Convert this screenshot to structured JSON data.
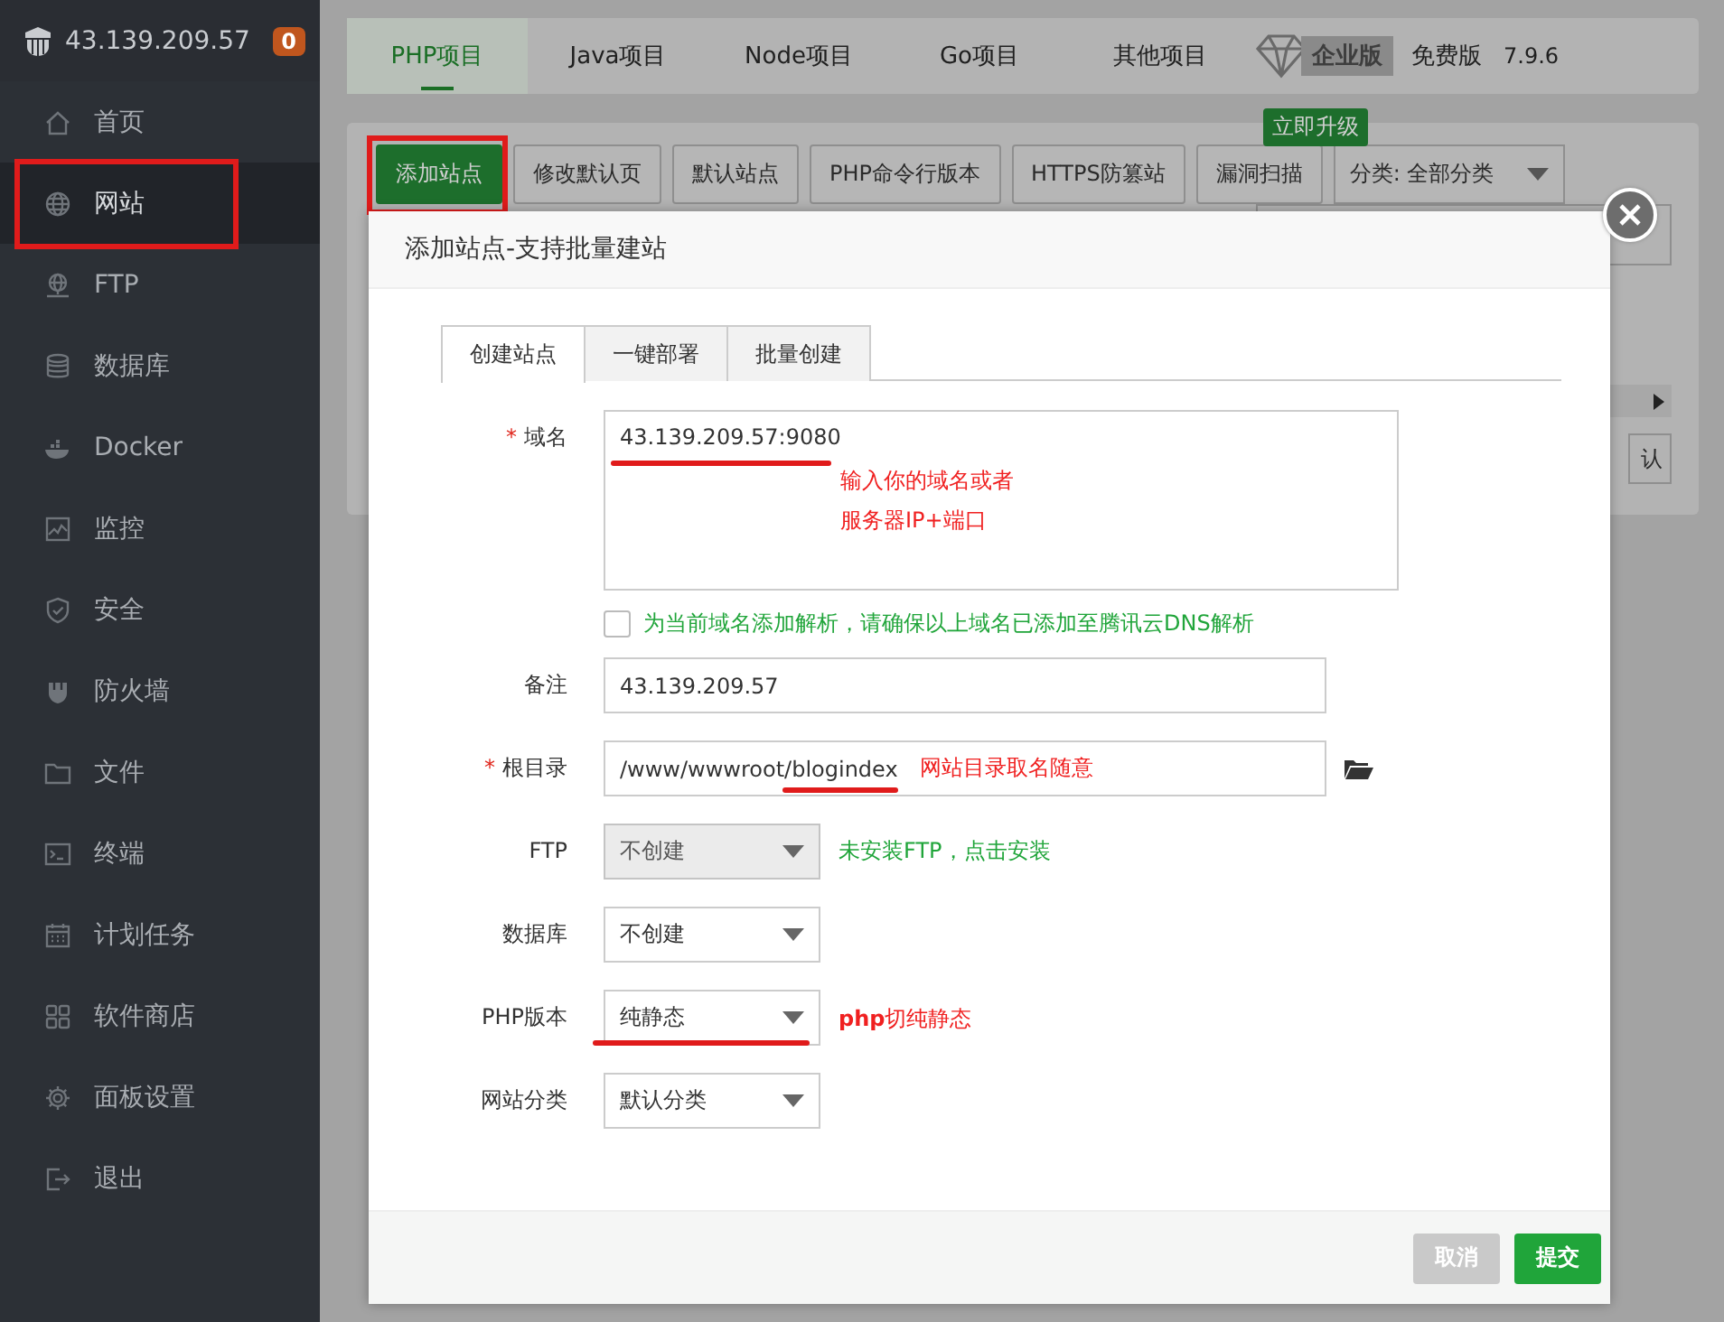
{
  "sidebar": {
    "host": "43.139.209.57",
    "badge": "0",
    "items": [
      {
        "label": "首页",
        "selected": false
      },
      {
        "label": "网站",
        "selected": true
      },
      {
        "label": "FTP",
        "selected": false
      },
      {
        "label": "数据库",
        "selected": false
      },
      {
        "label": "Docker",
        "selected": false
      },
      {
        "label": "监控",
        "selected": false
      },
      {
        "label": "安全",
        "selected": false
      },
      {
        "label": "防火墙",
        "selected": false
      },
      {
        "label": "文件",
        "selected": false
      },
      {
        "label": "终端",
        "selected": false
      },
      {
        "label": "计划任务",
        "selected": false
      },
      {
        "label": "软件商店",
        "selected": false
      },
      {
        "label": "面板设置",
        "selected": false
      },
      {
        "label": "退出",
        "selected": false
      }
    ]
  },
  "project_tabs": [
    {
      "label": "PHP项目",
      "selected": true
    },
    {
      "label": "Java项目",
      "selected": false
    },
    {
      "label": "Node项目",
      "selected": false
    },
    {
      "label": "Go项目",
      "selected": false
    },
    {
      "label": "其他项目",
      "selected": false
    }
  ],
  "edition": {
    "badge": "企业版",
    "label": "免费版",
    "version": "7.9.6"
  },
  "toolbar": {
    "buttons": [
      {
        "label": "添加站点",
        "primary": true
      },
      {
        "label": "修改默认页",
        "primary": false
      },
      {
        "label": "默认站点",
        "primary": false
      },
      {
        "label": "PHP命令行版本",
        "primary": false
      },
      {
        "label": "HTTPS防篡站",
        "primary": false
      },
      {
        "label": "漏洞扫描",
        "primary": false
      }
    ],
    "upgrade_badge": "立即升级",
    "category_select": "分类: 全部分类"
  },
  "background_button": "认",
  "dialog": {
    "title": "添加站点-支持批量建站",
    "tabs": [
      {
        "label": "创建站点",
        "selected": true
      },
      {
        "label": "一键部署",
        "selected": false
      },
      {
        "label": "批量创建",
        "selected": false
      }
    ],
    "fields": [
      {
        "kind": "textarea",
        "label": "域名",
        "required_mark": "*",
        "value": "43.139.209.57:9080",
        "annotation": [
          "输入你的域名或者",
          "服务器IP+端口"
        ]
      },
      {
        "kind": "checkbox",
        "label": "为当前域名添加解析，请确保以上域名已添加至腾讯云DNS解析",
        "checked": false
      },
      {
        "kind": "input",
        "label": "备注",
        "value": "43.139.209.57"
      },
      {
        "kind": "path",
        "label": "根目录",
        "required_mark": "*",
        "value": "/www/wwwroot/blogindex",
        "annotation": [
          "网站目录取名随意"
        ]
      },
      {
        "kind": "select",
        "label": "FTP",
        "value": "不创建",
        "disabled": true,
        "hint": "未安装FTP，点击安装"
      },
      {
        "kind": "select",
        "label": "数据库",
        "value": "不创建",
        "disabled": false
      },
      {
        "kind": "select",
        "label": "PHP版本",
        "value": "纯静态",
        "disabled": false,
        "annotation": [
          "**php**切纯静态"
        ]
      },
      {
        "kind": "select",
        "label": "网站分类",
        "value": "默认分类",
        "disabled": false
      }
    ],
    "buttons": [
      {
        "label": "取消",
        "kind": "cancel"
      },
      {
        "label": "提交",
        "kind": "submit"
      }
    ]
  }
}
